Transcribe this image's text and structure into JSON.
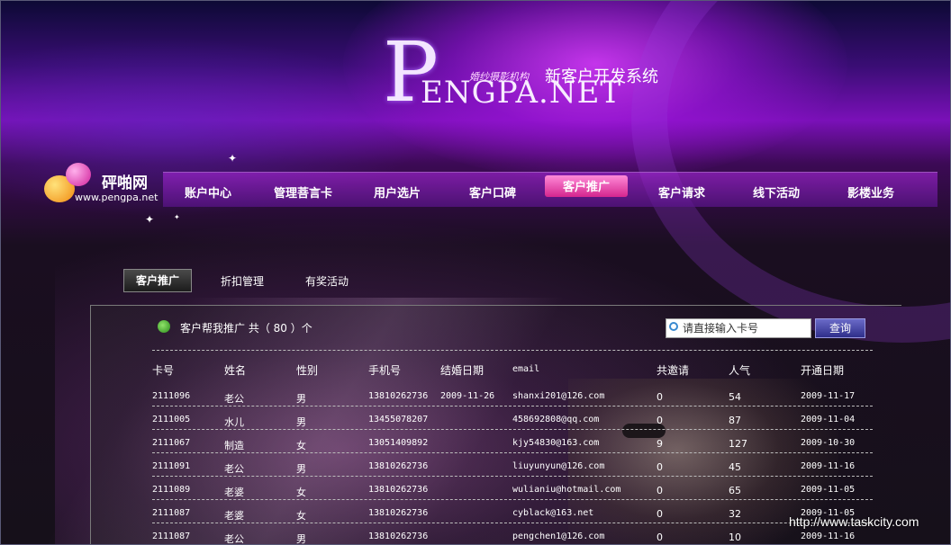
{
  "logo": {
    "letter": "P",
    "wordmark": "ENGPA.NET",
    "tagline": "婚纱摄影机构",
    "system_name": "新客户开发系统"
  },
  "brand": {
    "name": "砰啪网",
    "url": "www.pengpa.net"
  },
  "nav": {
    "items": [
      {
        "label": "账户中心"
      },
      {
        "label": "管理菩言卡"
      },
      {
        "label": "用户选片"
      },
      {
        "label": "客户口碑"
      },
      {
        "label": "客户推广"
      },
      {
        "label": "客户请求"
      },
      {
        "label": "线下活动"
      },
      {
        "label": "影楼业务"
      }
    ],
    "active": "客户推广"
  },
  "subtabs": {
    "items": [
      {
        "label": "客户推广"
      },
      {
        "label": "折扣管理"
      },
      {
        "label": "有奖活动"
      }
    ],
    "active": "客户推广"
  },
  "list": {
    "title": "客户帮我推广 共（ 80 ）个",
    "search_placeholder": "请直接输入卡号",
    "query_label": "查询"
  },
  "table": {
    "headers": [
      "卡号",
      "姓名",
      "性别",
      "手机号",
      "结婚日期",
      "email",
      "共邀请",
      "人气",
      "开通日期"
    ],
    "rows": [
      [
        "2111096",
        "老公",
        "男",
        "13810262736",
        "2009-11-26",
        "shanxi201@126.com",
        "0",
        "54",
        "2009-11-17"
      ],
      [
        "2111005",
        "水儿",
        "男",
        "13455078207",
        "",
        "458692808@qq.com",
        "0",
        "87",
        "2009-11-04"
      ],
      [
        "2111067",
        "制造",
        "女",
        "13051409892",
        "",
        "kjy54830@163.com",
        "9",
        "127",
        "2009-10-30"
      ],
      [
        "2111091",
        "老公",
        "男",
        "13810262736",
        "",
        "liuyunyun@126.com",
        "0",
        "45",
        "2009-11-16"
      ],
      [
        "2111089",
        "老婆",
        "女",
        "13810262736",
        "",
        "wulianiu@hotmail.com",
        "0",
        "65",
        "2009-11-05"
      ],
      [
        "2111087",
        "老婆",
        "女",
        "13810262736",
        "",
        "cyblack@163.net",
        "0",
        "32",
        "2009-11-05"
      ],
      [
        "2111087",
        "老公",
        "男",
        "13810262736",
        "",
        "pengchen1@126.com",
        "0",
        "10",
        "2009-11-16"
      ]
    ]
  },
  "watermark": "http://www.taskcity.com"
}
